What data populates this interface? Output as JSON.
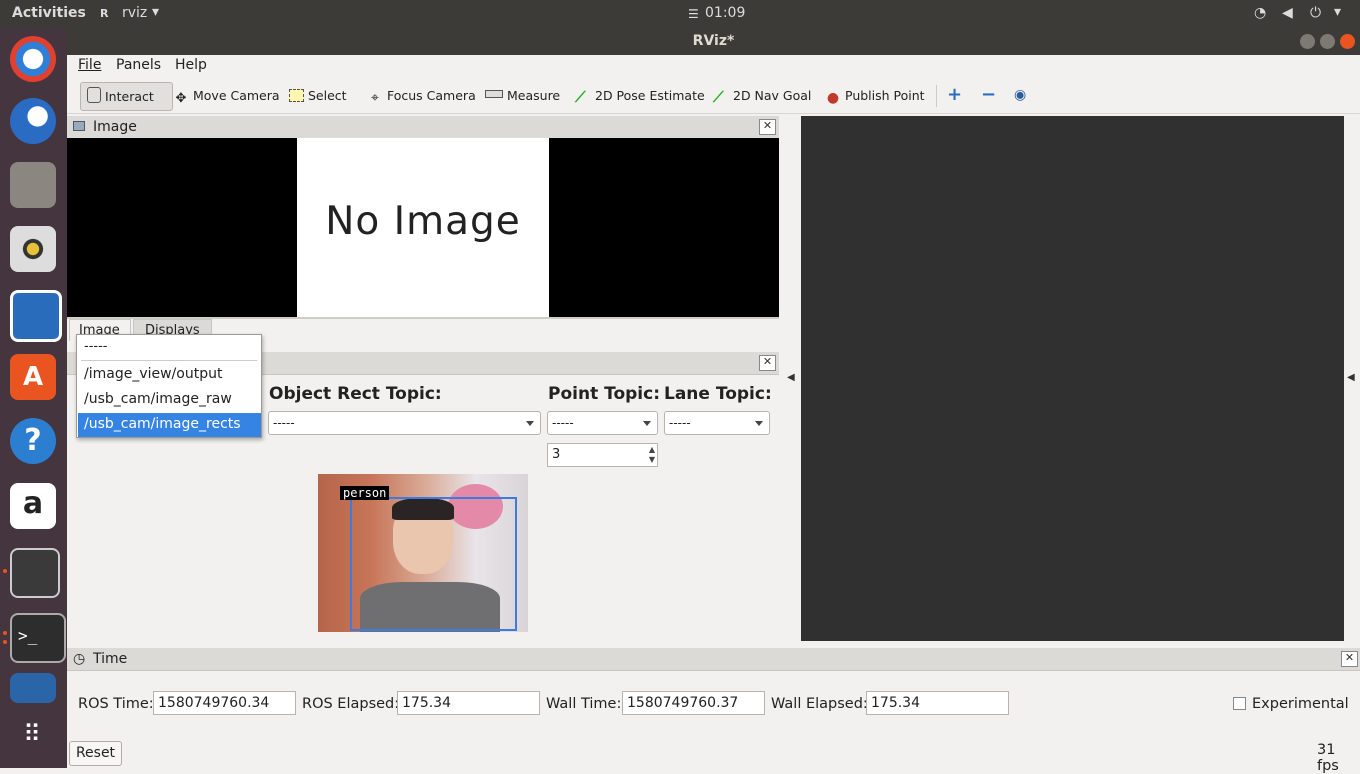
{
  "topbar": {
    "activities": "Activities",
    "app": "rviz",
    "clock": "01:09"
  },
  "window": {
    "title": "RViz*"
  },
  "menu": {
    "items": [
      "File",
      "Panels",
      "Help"
    ]
  },
  "toolbar": {
    "tools": [
      {
        "label": "Interact",
        "icon": "hand-icon"
      },
      {
        "label": "Move Camera",
        "icon": "move-icon"
      },
      {
        "label": "Select",
        "icon": "select-box-icon"
      },
      {
        "label": "Focus Camera",
        "icon": "focus-icon"
      },
      {
        "label": "Measure",
        "icon": "ruler-icon"
      },
      {
        "label": "2D Pose Estimate",
        "icon": "green-arrow-icon"
      },
      {
        "label": "2D Nav Goal",
        "icon": "green-arrow-icon"
      },
      {
        "label": "Publish Point",
        "icon": "map-pin-icon"
      }
    ]
  },
  "image_panel": {
    "title": "Image",
    "placeholder": "No Image"
  },
  "tabs": {
    "image": "Image",
    "displays": "Displays"
  },
  "dropdown": {
    "options": [
      "-----",
      "/image_view/output",
      "/usb_cam/image_raw",
      "/usb_cam/image_rects"
    ],
    "selected_index": 3
  },
  "plugin": {
    "object_rect_label": "Object Rect Topic:",
    "object_rect_value": "-----",
    "point_label": "Point Topic:",
    "point_value": "-----",
    "lane_label": "Lane Topic:",
    "lane_value": "-----",
    "spin_value": "3",
    "detection_label": "person"
  },
  "time_panel": {
    "title": "Time",
    "ros_time_label": "ROS Time:",
    "ros_time": "1580749760.34",
    "ros_elapsed_label": "ROS Elapsed:",
    "ros_elapsed": "175.34",
    "wall_time_label": "Wall Time:",
    "wall_time": "1580749760.37",
    "wall_elapsed_label": "Wall Elapsed:",
    "wall_elapsed": "175.34",
    "experimental": "Experimental",
    "reset": "Reset",
    "fps": "31 fps"
  }
}
